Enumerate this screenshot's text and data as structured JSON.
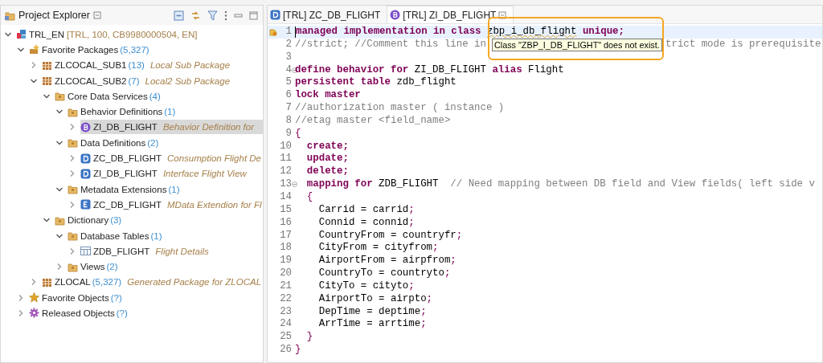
{
  "explorer": {
    "title": "Project Explorer",
    "items": [
      {
        "kind": "system",
        "name": "TRL_EN",
        "detail": "[TRL, 100, CB9980000504, EN]",
        "expanded": true,
        "selected": false,
        "children": [
          {
            "kind": "favorites",
            "name": "Favorite Packages",
            "count": "(5,327)",
            "expanded": true,
            "selected": false,
            "children": [
              {
                "kind": "package",
                "name": "ZLCOCAL_SUB1",
                "count": "(13)",
                "description": "Local Sub Package",
                "expanded": false,
                "selected": false
              },
              {
                "kind": "package",
                "name": "ZLCOCAL_SUB2",
                "count": "(7)",
                "description": "Local2 Sub Package",
                "expanded": true,
                "selected": false,
                "children": [
                  {
                    "kind": "folder",
                    "name": "Core Data Services",
                    "count": "(4)",
                    "expanded": true,
                    "selected": false,
                    "children": [
                      {
                        "kind": "folder",
                        "name": "Behavior Definitions",
                        "count": "(1)",
                        "expanded": true,
                        "selected": false,
                        "children": [
                          {
                            "kind": "bdef",
                            "name": "ZI_DB_FLIGHT",
                            "description": "Behavior Definition for",
                            "expanded": false,
                            "selected": true
                          }
                        ]
                      },
                      {
                        "kind": "folder",
                        "name": "Data Definitions",
                        "count": "(2)",
                        "expanded": true,
                        "selected": false,
                        "children": [
                          {
                            "kind": "ddef",
                            "name": "ZC_DB_FLIGHT",
                            "description": "Consumption Flight De",
                            "expanded": false,
                            "selected": false
                          },
                          {
                            "kind": "ddef",
                            "name": "ZI_DB_FLIGHT",
                            "description": "Interface Flight View",
                            "expanded": false,
                            "selected": false
                          }
                        ]
                      },
                      {
                        "kind": "folder",
                        "name": "Metadata Extensions",
                        "count": "(1)",
                        "expanded": true,
                        "selected": false,
                        "children": [
                          {
                            "kind": "ddlx",
                            "name": "ZC_DB_FLIGHT",
                            "description": "MData Extendion for Fl",
                            "expanded": false,
                            "selected": false
                          }
                        ]
                      }
                    ]
                  },
                  {
                    "kind": "folder",
                    "name": "Dictionary",
                    "count": "(3)",
                    "expanded": true,
                    "selected": false,
                    "children": [
                      {
                        "kind": "folder",
                        "name": "Database Tables",
                        "count": "(1)",
                        "expanded": true,
                        "selected": false,
                        "children": [
                          {
                            "kind": "table",
                            "name": "ZDB_FLIGHT",
                            "description": "Flight Details",
                            "expanded": false,
                            "selected": false
                          }
                        ]
                      },
                      {
                        "kind": "folder",
                        "name": "Views",
                        "count": "(2)",
                        "expanded": false,
                        "selected": false
                      }
                    ]
                  }
                ]
              },
              {
                "kind": "package",
                "name": "ZLOCAL",
                "count": "(5,327)",
                "description": "Generated Package for ZLOCAL",
                "expanded": false,
                "selected": false
              }
            ]
          },
          {
            "kind": "star",
            "name": "Favorite Objects",
            "count": "(?)",
            "expanded": false,
            "selected": false
          },
          {
            "kind": "gear",
            "name": "Released Objects",
            "count": "(?)",
            "expanded": false,
            "selected": false
          }
        ]
      }
    ]
  },
  "editor": {
    "tabs": [
      {
        "kind": "ddef",
        "label": "[TRL] ZC_DB_FLIGHT",
        "selected": false
      },
      {
        "kind": "bdef",
        "label": "[TRL] ZI_DB_FLIGHT",
        "selected": true
      }
    ],
    "lines": [
      {
        "number": "1",
        "current": true,
        "marker": true,
        "fold": false,
        "tokens": [
          {
            "kind": "kw",
            "text": "managed implementation in class "
          },
          {
            "kind": "error",
            "text": "zbp_i_db_flight"
          },
          {
            "kind": "kw",
            "text": " unique;"
          }
        ]
      },
      {
        "number": "2",
        "current": false,
        "marker": false,
        "fold": false,
        "tokens": [
          {
            "kind": "comment",
            "text": "//strict; //Comment this line in"
          },
          {
            "kind": "resume",
            "text": "trict mode is prerequisite"
          }
        ]
      },
      {
        "number": "3",
        "current": false,
        "marker": false,
        "fold": false
      },
      {
        "number": "4",
        "current": false,
        "marker": false,
        "fold": true,
        "tokens": [
          {
            "kind": "kw",
            "text": "define behavior for"
          },
          {
            "kind": "plain",
            "text": " ZI_DB_FLIGHT "
          },
          {
            "kind": "kw",
            "text": "alias"
          },
          {
            "kind": "plain",
            "text": " Flight"
          }
        ]
      },
      {
        "number": "5",
        "current": false,
        "marker": false,
        "fold": false,
        "tokens": [
          {
            "kind": "kw",
            "text": "persistent table"
          },
          {
            "kind": "plain",
            "text": " zdb_flight"
          }
        ]
      },
      {
        "number": "6",
        "current": false,
        "marker": false,
        "fold": false,
        "tokens": [
          {
            "kind": "kw",
            "text": "lock master"
          }
        ]
      },
      {
        "number": "7",
        "current": false,
        "marker": false,
        "fold": false,
        "tokens": [
          {
            "kind": "comment",
            "text": "//authorization master ( instance )"
          }
        ]
      },
      {
        "number": "8",
        "current": false,
        "marker": false,
        "fold": false,
        "tokens": [
          {
            "kind": "comment",
            "text": "//etag master <field_name>"
          }
        ]
      },
      {
        "number": "9",
        "current": false,
        "marker": false,
        "fold": false,
        "tokens": [
          {
            "kind": "punct",
            "text": "{"
          }
        ]
      },
      {
        "number": "10",
        "current": false,
        "marker": false,
        "fold": false,
        "tokens": [
          {
            "kind": "kw",
            "text": "  create;"
          }
        ]
      },
      {
        "number": "11",
        "current": false,
        "marker": false,
        "fold": false,
        "tokens": [
          {
            "kind": "kw",
            "text": "  update;"
          }
        ]
      },
      {
        "number": "12",
        "current": false,
        "marker": false,
        "fold": false,
        "tokens": [
          {
            "kind": "kw",
            "text": "  delete;"
          }
        ]
      },
      {
        "number": "13",
        "current": false,
        "marker": false,
        "fold": true,
        "tokens": [
          {
            "kind": "kw",
            "text": "  mapping for"
          },
          {
            "kind": "plain",
            "text": " ZDB_FLIGHT  "
          },
          {
            "kind": "comment",
            "text": "// Need mapping between DB field and View fields( left side v"
          }
        ]
      },
      {
        "number": "14",
        "current": false,
        "marker": false,
        "fold": false,
        "tokens": [
          {
            "kind": "punct",
            "text": "  {"
          }
        ]
      },
      {
        "number": "15",
        "current": false,
        "marker": false,
        "fold": false,
        "tokens": [
          {
            "kind": "plain",
            "text": "    Carrid = carrid"
          },
          {
            "kind": "punct",
            "text": ";"
          }
        ]
      },
      {
        "number": "16",
        "current": false,
        "marker": false,
        "fold": false,
        "tokens": [
          {
            "kind": "plain",
            "text": "    Connid = connid"
          },
          {
            "kind": "punct",
            "text": ";"
          }
        ]
      },
      {
        "number": "17",
        "current": false,
        "marker": false,
        "fold": false,
        "tokens": [
          {
            "kind": "plain",
            "text": "    CountryFrom = countryfr"
          },
          {
            "kind": "punct",
            "text": ";"
          }
        ]
      },
      {
        "number": "18",
        "current": false,
        "marker": false,
        "fold": false,
        "tokens": [
          {
            "kind": "plain",
            "text": "    CityFrom = cityfrom"
          },
          {
            "kind": "punct",
            "text": ";"
          }
        ]
      },
      {
        "number": "19",
        "current": false,
        "marker": false,
        "fold": false,
        "tokens": [
          {
            "kind": "plain",
            "text": "    AirportFrom = airpfrom"
          },
          {
            "kind": "punct",
            "text": ";"
          }
        ]
      },
      {
        "number": "20",
        "current": false,
        "marker": false,
        "fold": false,
        "tokens": [
          {
            "kind": "plain",
            "text": "    CountryTo = countryto"
          },
          {
            "kind": "punct",
            "text": ";"
          }
        ]
      },
      {
        "number": "21",
        "current": false,
        "marker": false,
        "fold": false,
        "tokens": [
          {
            "kind": "plain",
            "text": "    CityTo = cityto"
          },
          {
            "kind": "punct",
            "text": ";"
          }
        ]
      },
      {
        "number": "22",
        "current": false,
        "marker": false,
        "fold": false,
        "tokens": [
          {
            "kind": "plain",
            "text": "    AirportTo = airpto"
          },
          {
            "kind": "punct",
            "text": ";"
          }
        ]
      },
      {
        "number": "23",
        "current": false,
        "marker": false,
        "fold": false,
        "tokens": [
          {
            "kind": "plain",
            "text": "    DepTime = deptime"
          },
          {
            "kind": "punct",
            "text": ";"
          }
        ]
      },
      {
        "number": "24",
        "current": false,
        "marker": false,
        "fold": false,
        "tokens": [
          {
            "kind": "plain",
            "text": "    ArrTime = arrtime"
          },
          {
            "kind": "punct",
            "text": ";"
          }
        ]
      },
      {
        "number": "25",
        "current": false,
        "marker": false,
        "fold": false,
        "tokens": [
          {
            "kind": "punct",
            "text": "  }"
          }
        ]
      },
      {
        "number": "26",
        "current": false,
        "marker": false,
        "fold": false,
        "tokens": [
          {
            "kind": "punct",
            "text": "}"
          }
        ]
      }
    ],
    "tooltip": {
      "text": "Class \"ZBP_I_DB_FLIGHT\" does not exist."
    }
  }
}
